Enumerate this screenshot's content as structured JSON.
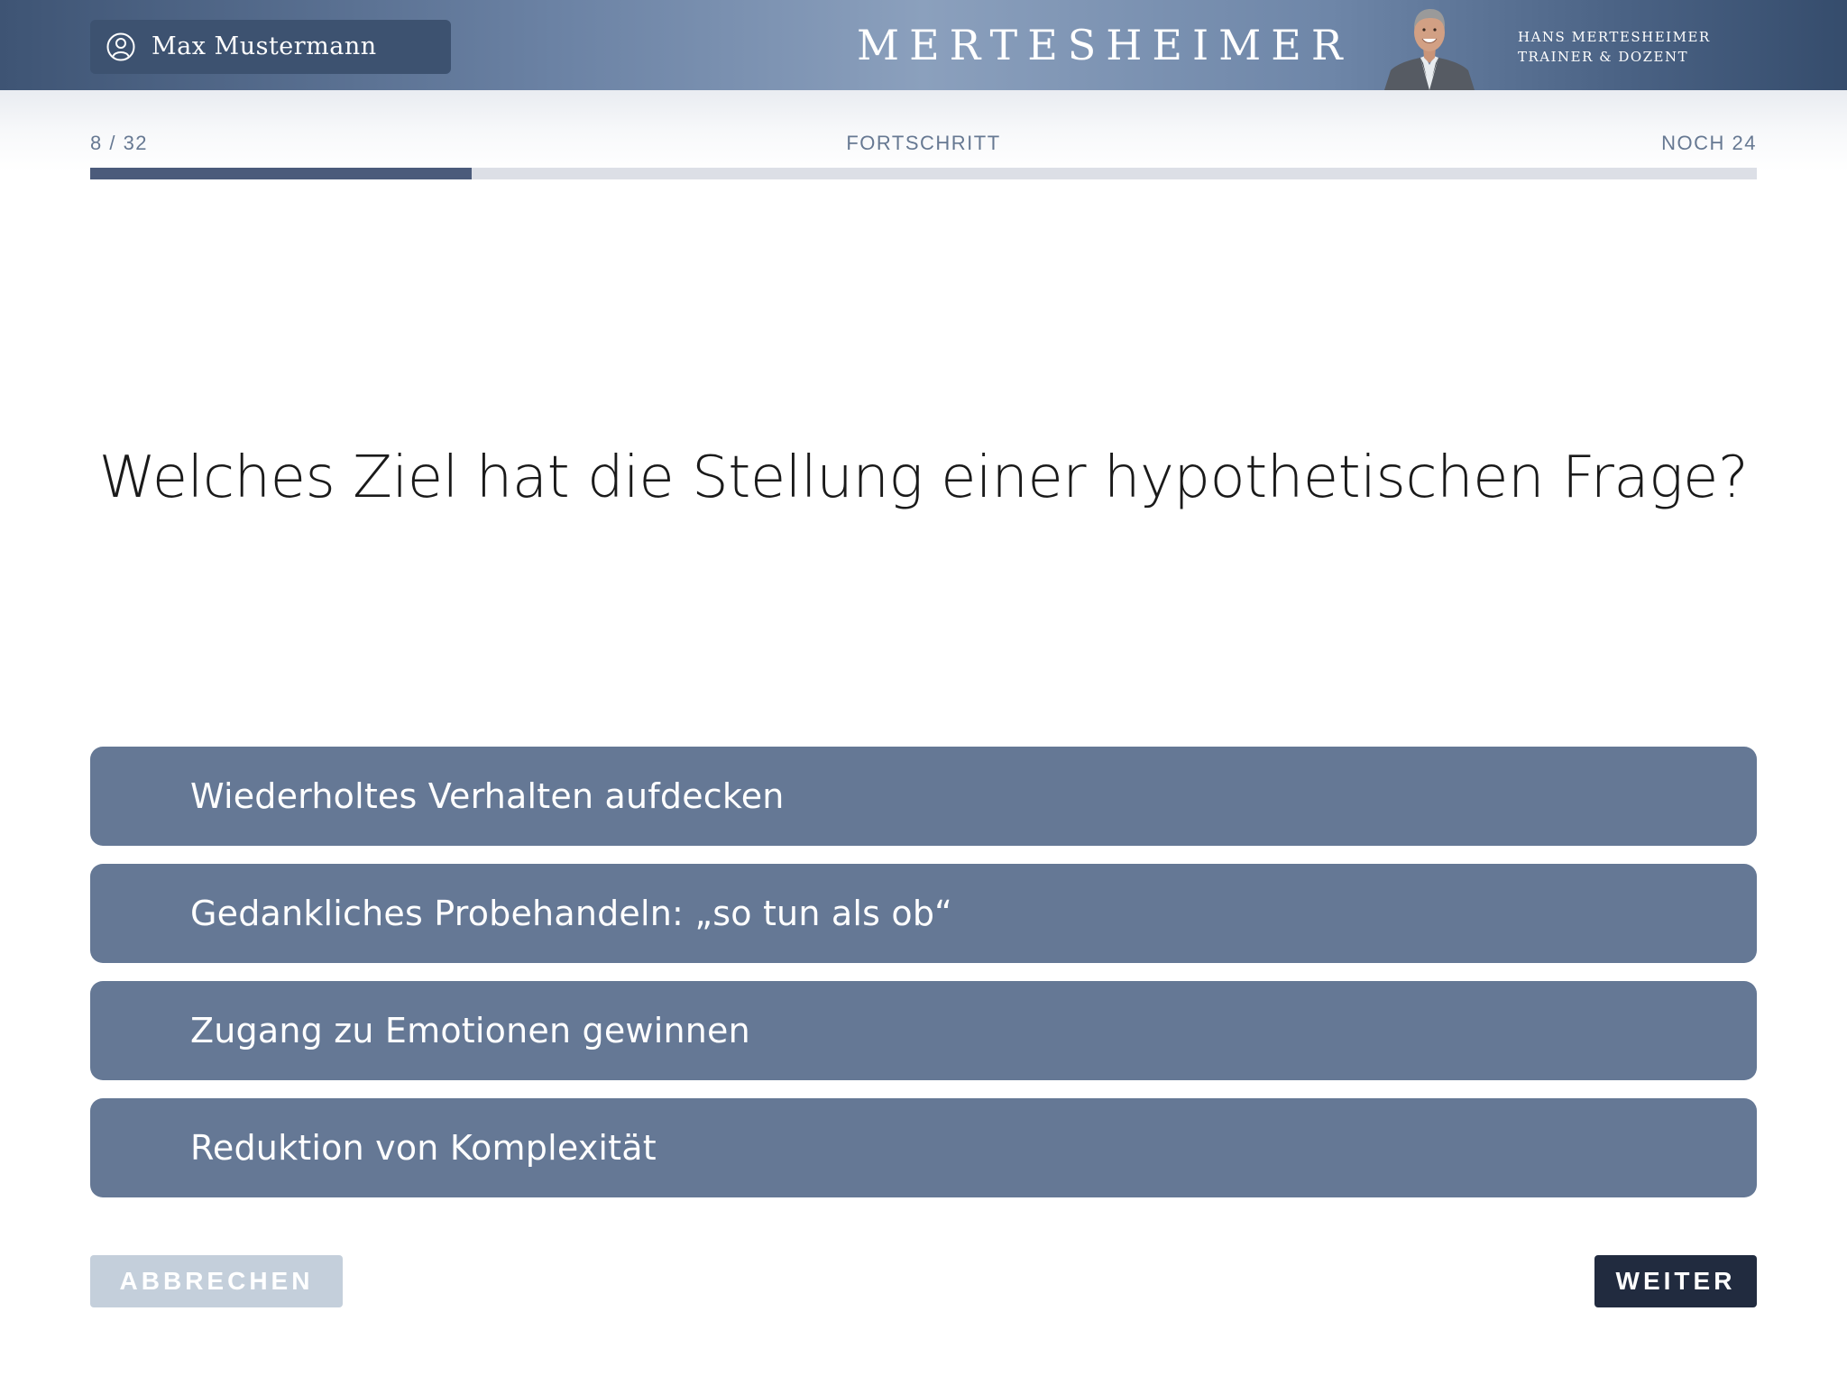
{
  "header": {
    "user_name": "Max Mustermann",
    "brand": "MERTESHEIMER",
    "trainer_name": "HANS MERTESHEIMER",
    "trainer_role": "TRAINER & DOZENT"
  },
  "progress": {
    "count": "8 / 32",
    "title": "FORTSCHRITT",
    "remaining": "NOCH 24",
    "fraction": 0.229
  },
  "question": "Welches Ziel hat die Stellung einer hypothetischen Frage?",
  "answers": [
    {
      "label": "Wiederholtes Verhalten aufdecken"
    },
    {
      "label": "Gedankliches Probehandeln: „so tun als ob“"
    },
    {
      "label": "Zugang zu Emotionen gewinnen"
    },
    {
      "label": "Reduktion von Komplexität"
    }
  ],
  "buttons": {
    "cancel_label": "ABBRECHEN",
    "next_label": "WEITER"
  },
  "colors": {
    "header_dark": "#3d5270",
    "answer_bg": "#657895",
    "progress_fill": "#4b5b7b",
    "progress_track": "#dcdfe6",
    "next_bg": "#212b3f",
    "cancel_bg": "#c4cfdb"
  },
  "icons": {
    "user": "user-circle-icon"
  }
}
